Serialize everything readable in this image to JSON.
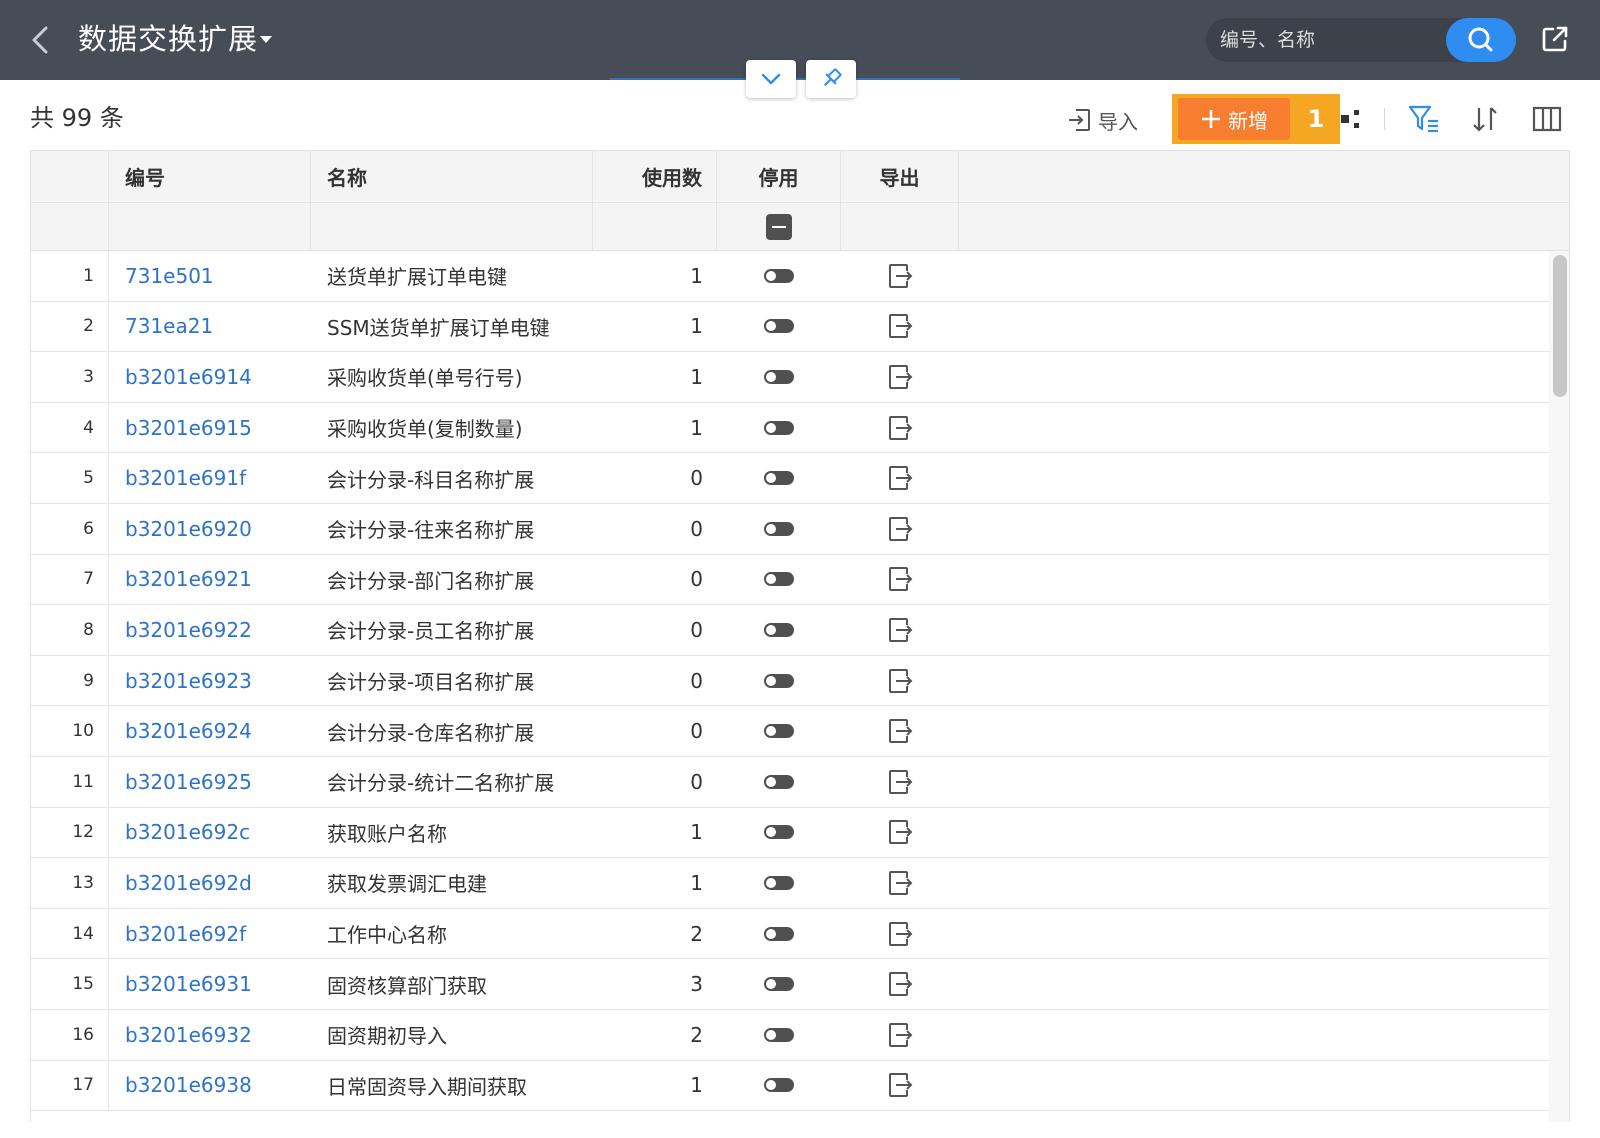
{
  "header": {
    "title": "数据交换扩展",
    "back_icon": "chevron-left-icon",
    "search": {
      "placeholder": "编号、名称",
      "value": ""
    },
    "brand_color": "#474d57",
    "accent_color": "#2f8cf0"
  },
  "toolbar": {
    "count_label": "共 99 条",
    "import_label": "导入",
    "add_label": "新增",
    "add_color": "#f77d2f",
    "highlight_badge": "1",
    "icons": [
      "import-icon",
      "plus-icon",
      "more-icon",
      "filter-icon",
      "sort-icon",
      "columns-icon"
    ]
  },
  "table": {
    "columns": [
      "编号",
      "名称",
      "使用数",
      "停用",
      "导出"
    ],
    "rows": [
      {
        "index": "1",
        "code": "731e501",
        "name": "送货单扩展订单电键",
        "uses": "1"
      },
      {
        "index": "2",
        "code": "731ea21",
        "name": "SSM送货单扩展订单电键",
        "uses": "1"
      },
      {
        "index": "3",
        "code": "b3201e6914",
        "name": "采购收货单(单号行号)",
        "uses": "1"
      },
      {
        "index": "4",
        "code": "b3201e6915",
        "name": "采购收货单(复制数量)",
        "uses": "1"
      },
      {
        "index": "5",
        "code": "b3201e691f",
        "name": "会计分录-科目名称扩展",
        "uses": "0"
      },
      {
        "index": "6",
        "code": "b3201e6920",
        "name": "会计分录-往来名称扩展",
        "uses": "0"
      },
      {
        "index": "7",
        "code": "b3201e6921",
        "name": "会计分录-部门名称扩展",
        "uses": "0"
      },
      {
        "index": "8",
        "code": "b3201e6922",
        "name": "会计分录-员工名称扩展",
        "uses": "0"
      },
      {
        "index": "9",
        "code": "b3201e6923",
        "name": "会计分录-项目名称扩展",
        "uses": "0"
      },
      {
        "index": "10",
        "code": "b3201e6924",
        "name": "会计分录-仓库名称扩展",
        "uses": "0"
      },
      {
        "index": "11",
        "code": "b3201e6925",
        "name": "会计分录-统计二名称扩展",
        "uses": "0"
      },
      {
        "index": "12",
        "code": "b3201e692c",
        "name": "获取账户名称",
        "uses": "1"
      },
      {
        "index": "13",
        "code": "b3201e692d",
        "name": "获取发票调汇电建",
        "uses": "1"
      },
      {
        "index": "14",
        "code": "b3201e692f",
        "name": "工作中心名称",
        "uses": "2"
      },
      {
        "index": "15",
        "code": "b3201e6931",
        "name": "固资核算部门获取",
        "uses": "3"
      },
      {
        "index": "16",
        "code": "b3201e6932",
        "name": "固资期初导入",
        "uses": "2"
      },
      {
        "index": "17",
        "code": "b3201e6938",
        "name": "日常固资导入期间获取",
        "uses": "1"
      }
    ]
  }
}
